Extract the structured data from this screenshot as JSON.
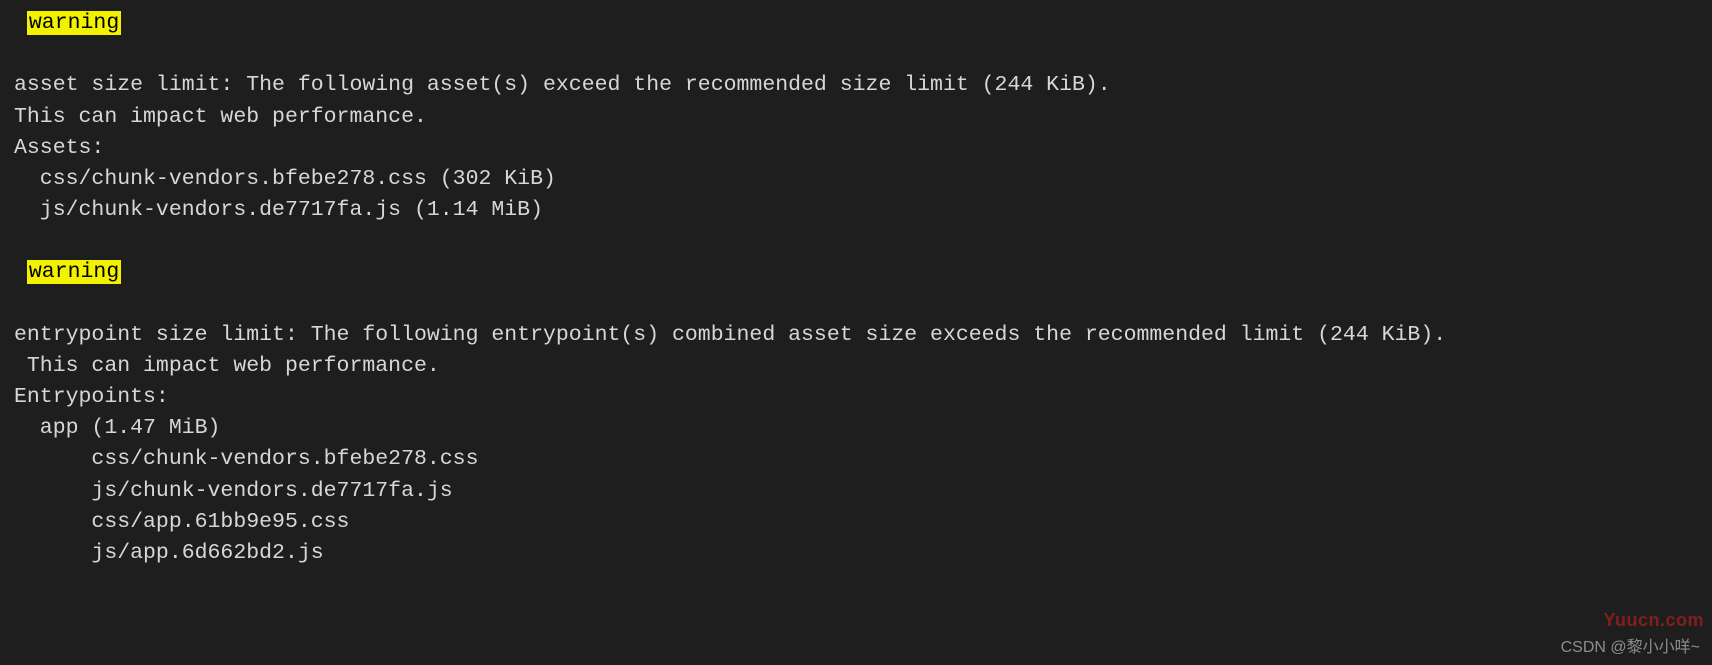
{
  "warnings": [
    {
      "tag": "warning",
      "lines": [
        "asset size limit: The following asset(s) exceed the recommended size limit (244 KiB).",
        "This can impact web performance.",
        "Assets:",
        "  css/chunk-vendors.bfebe278.css (302 KiB)",
        "  js/chunk-vendors.de7717fa.js (1.14 MiB)"
      ]
    },
    {
      "tag": "warning",
      "lines": [
        "entrypoint size limit: The following entrypoint(s) combined asset size exceeds the recommended limit (244 KiB).",
        " This can impact web performance.",
        "Entrypoints:",
        "  app (1.47 MiB)",
        "      css/chunk-vendors.bfebe278.css",
        "      js/chunk-vendors.de7717fa.js",
        "      css/app.61bb9e95.css",
        "      js/app.6d662bd2.js"
      ]
    }
  ],
  "watermark": "Yuucn.com",
  "credit": "CSDN @黎小小咩~"
}
